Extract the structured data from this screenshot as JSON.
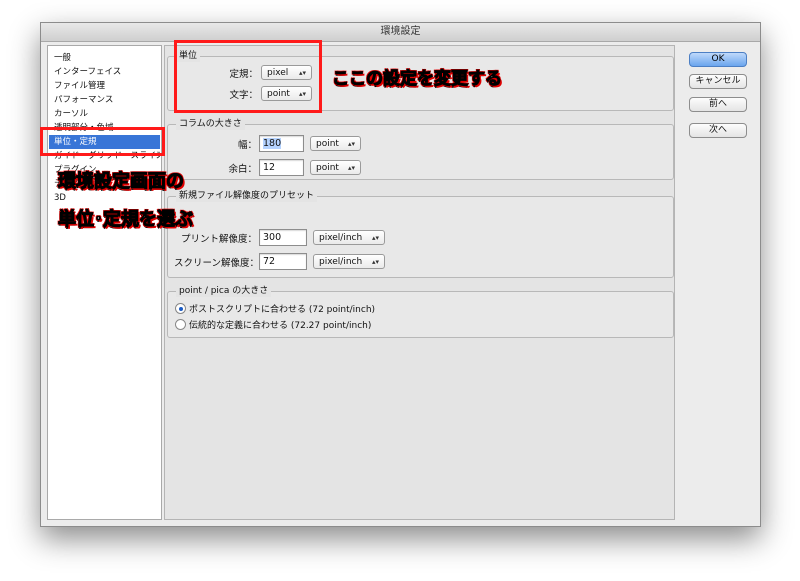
{
  "window": {
    "title": "環境設定"
  },
  "sidebar": {
    "items": [
      {
        "label": "一般",
        "selected": false
      },
      {
        "label": "インターフェイス",
        "selected": false
      },
      {
        "label": "ファイル管理",
        "selected": false
      },
      {
        "label": "パフォーマンス",
        "selected": false
      },
      {
        "label": "カーソル",
        "selected": false
      },
      {
        "label": "透明部分・色域",
        "selected": false
      },
      {
        "label": "単位・定規",
        "selected": true
      },
      {
        "label": "ガイド・グリッド・スライス",
        "selected": false
      },
      {
        "label": "プラグイン",
        "selected": false
      },
      {
        "label": "テキスト",
        "selected": false
      },
      {
        "label": "3D",
        "selected": false
      }
    ]
  },
  "units": {
    "title": "単位",
    "rulers_label": "定規：",
    "rulers_value": "pixel",
    "type_label": "文字：",
    "type_value": "point"
  },
  "columns": {
    "title": "コラムの大きさ",
    "width_label": "幅：",
    "width_value": "180",
    "width_unit": "point",
    "gutter_label": "余白：",
    "gutter_value": "12",
    "gutter_unit": "point"
  },
  "presets": {
    "title": "新規ファイル解像度のプリセット",
    "print_label": "プリント解像度：",
    "print_value": "300",
    "print_unit": "pixel/inch",
    "screen_label": "スクリーン解像度：",
    "screen_value": "72",
    "screen_unit": "pixel/inch"
  },
  "pica": {
    "title": "point / pica の大きさ",
    "options": [
      {
        "label": "ポストスクリプトに合わせる (72 point/inch)",
        "selected": true
      },
      {
        "label": "伝統的な定義に合わせる (72.27 point/inch)",
        "selected": false
      }
    ]
  },
  "buttons": {
    "ok": "OK",
    "cancel": "キャンセル",
    "prev": "前へ",
    "next": "次へ"
  },
  "annotations": {
    "change_here": "ここの設定を変更する",
    "select_line1": "環境設定画面の",
    "select_line2": "単位･定規を選ぶ"
  },
  "colors": {
    "annotation_box": "#ff1a1a",
    "selection": "#3875d7",
    "default_button": "#6aa5ee"
  }
}
